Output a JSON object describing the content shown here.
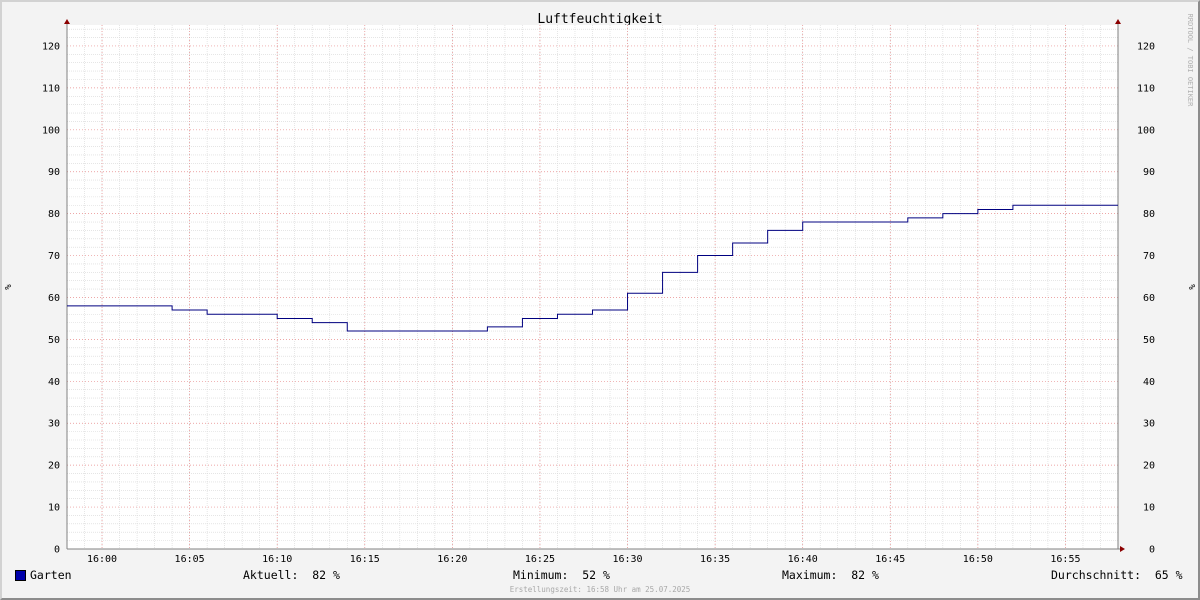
{
  "chart_data": {
    "type": "line",
    "title": "Luftfeuchtigkeit",
    "ylabel": "%",
    "ylim": [
      0,
      125
    ],
    "xlim_minutes": [
      "15:58",
      "16:58"
    ],
    "yticks": [
      0,
      10,
      20,
      30,
      40,
      50,
      60,
      70,
      80,
      90,
      100,
      110,
      120
    ],
    "xticks": [
      "16:00",
      "16:05",
      "16:10",
      "16:15",
      "16:20",
      "16:25",
      "16:30",
      "16:35",
      "16:40",
      "16:45",
      "16:50",
      "16:55"
    ],
    "grid": true,
    "series": [
      {
        "name": "Garten",
        "color": "#000080",
        "step": true,
        "points": [
          [
            "15:58",
            58
          ],
          [
            "16:04",
            57
          ],
          [
            "16:06",
            56
          ],
          [
            "16:10",
            55
          ],
          [
            "16:12",
            54
          ],
          [
            "16:14",
            52
          ],
          [
            "16:22",
            53
          ],
          [
            "16:24",
            55
          ],
          [
            "16:26",
            56
          ],
          [
            "16:28",
            57
          ],
          [
            "16:30",
            61
          ],
          [
            "16:32",
            66
          ],
          [
            "16:34",
            70
          ],
          [
            "16:36",
            73
          ],
          [
            "16:38",
            76
          ],
          [
            "16:40",
            78
          ],
          [
            "16:46",
            79
          ],
          [
            "16:48",
            80
          ],
          [
            "16:50",
            81
          ],
          [
            "16:52",
            82
          ],
          [
            "16:58",
            82
          ]
        ]
      }
    ]
  },
  "watermark_side": "RRDTOOL / TOBI OETIKER",
  "legend": {
    "series_name": "Garten",
    "series_color": "#0000aa",
    "aktuell": "Aktuell:  82 %",
    "minimum": "Minimum:  52 %",
    "maximum": "Maximum:  82 %",
    "durchschnitt": "Durchschnitt:  65 %"
  },
  "footer": "Erstellungszeit: 16:58 Uhr am 25.07.2025"
}
